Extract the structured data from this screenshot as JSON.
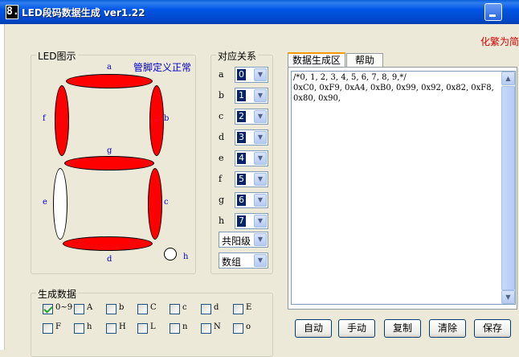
{
  "window": {
    "title": "LED段码数据生成 ver1.22",
    "icon_glyph": "8."
  },
  "simplify_link": "化繁为简",
  "led_panel": {
    "legend": "LED图示",
    "pin_status": "管脚定义正常",
    "segments": {
      "a": "a",
      "b": "b",
      "c": "c",
      "d": "d",
      "e": "e",
      "f": "f",
      "g": "g",
      "h": "h"
    },
    "segment_state": {
      "a": "on",
      "b": "on",
      "c": "on",
      "d": "on",
      "e": "off",
      "f": "on",
      "g": "on",
      "h": "off"
    },
    "on_color": "#ff0000"
  },
  "mapping": {
    "legend": "对应关系",
    "rows": [
      {
        "key": "a",
        "value": "0"
      },
      {
        "key": "b",
        "value": "1"
      },
      {
        "key": "c",
        "value": "2"
      },
      {
        "key": "d",
        "value": "3"
      },
      {
        "key": "e",
        "value": "4"
      },
      {
        "key": "f",
        "value": "5"
      },
      {
        "key": "g",
        "value": "6"
      },
      {
        "key": "h",
        "value": "7"
      }
    ],
    "polarity": "共阳级",
    "format": "数组"
  },
  "tabs": [
    "数据生成区",
    "帮助"
  ],
  "code_output": "/*0, 1, 2, 3, 4, 5, 6, 7, 8, 9,*/\n0xC0, 0xF9, 0xA4, 0xB0, 0x99, 0x92, 0x82, 0xF8, 0x80, 0x90,",
  "buttons": {
    "auto": "自动",
    "manual": "手动",
    "copy": "复制",
    "clear": "清除",
    "save": "保存"
  },
  "generate": {
    "legend": "生成数据",
    "checks": [
      {
        "label": "0~9",
        "checked": true
      },
      {
        "label": "A",
        "checked": false
      },
      {
        "label": "b",
        "checked": false
      },
      {
        "label": "C",
        "checked": false
      },
      {
        "label": "c",
        "checked": false
      },
      {
        "label": "d",
        "checked": false
      },
      {
        "label": "E",
        "checked": false
      },
      {
        "label": "F",
        "checked": false
      },
      {
        "label": "h",
        "checked": false
      },
      {
        "label": "H",
        "checked": false
      },
      {
        "label": "L",
        "checked": false
      },
      {
        "label": "n",
        "checked": false
      },
      {
        "label": "N",
        "checked": false
      },
      {
        "label": "o",
        "checked": false
      }
    ]
  }
}
